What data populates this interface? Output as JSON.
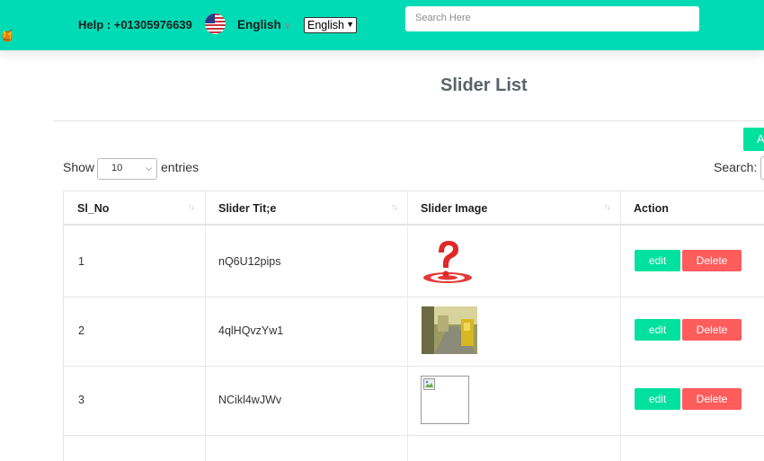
{
  "header": {
    "help_text": "Help : +01305976639",
    "language_label": "English",
    "language_select_value": "English",
    "search_placeholder": "Search Here",
    "brand_color": "#00dbb5"
  },
  "page": {
    "title": "Slider List",
    "add_button_label": "A",
    "show_label": "Show",
    "entries_value": "10",
    "entries_label": "entries",
    "search_label": "Search:"
  },
  "table": {
    "columns": [
      "Sl_No",
      "Slider Tit;e",
      "Slider Image",
      "Action"
    ],
    "rows": [
      {
        "sl_no": "1",
        "title": "nQ6U12pips",
        "image": "question-mark-target-image",
        "edit": "edit",
        "delete": "Delete"
      },
      {
        "sl_no": "2",
        "title": "4qlHQvzYw1",
        "image": "street-photo-image",
        "edit": "edit",
        "delete": "Delete"
      },
      {
        "sl_no": "3",
        "title": "NCikl4wJWv",
        "image": "broken-image",
        "edit": "edit",
        "delete": "Delete"
      }
    ]
  },
  "colors": {
    "edit_button": "#00e19f",
    "delete_button": "#ff5c5c"
  }
}
